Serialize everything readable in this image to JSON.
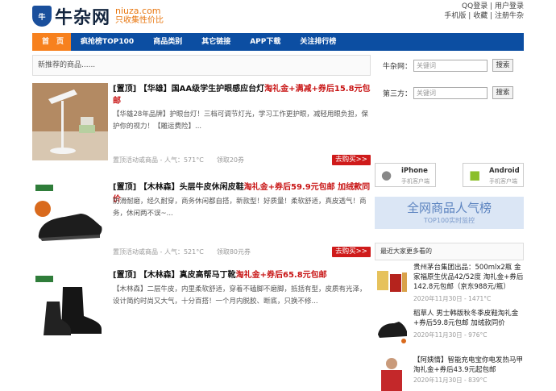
{
  "header": {
    "logo_badge": "牛",
    "logo_text": "牛杂网",
    "domain": "niuza.com",
    "slogan": "只收集性价比",
    "top_links": [
      "QQ登录",
      "用户登录",
      "手机版",
      "收藏",
      "注册牛杂"
    ]
  },
  "nav": {
    "items": [
      "首　页",
      "疯抢榜TOP100",
      "商品类别",
      "其它链接",
      "APP下载",
      "关注排行榜"
    ],
    "active_color": "#f7811e",
    "bar_color": "#0c4ea2"
  },
  "main": {
    "breadcrumb": "新推荐的商品......",
    "posts": [
      {
        "title_prefix": "[置顶] 【华雄】国AA级学生护眼感应台灯",
        "title_red": "淘礼金+满减+券后15.8元包邮",
        "desc": "【华雄28年品牌】护眼台灯！三档可调节灯光，学习工作更护眼，减轻用眼负担，保护你的视力！【雕运费险】...",
        "meta": "置顶活动或商品 - 人气：571°C　　领取20券",
        "buy": "去购买>>"
      },
      {
        "title_prefix": "[置顶] 【木林森】头层牛皮休闲皮鞋",
        "title_red": "淘礼金+券后59.9元包邮 加绒款同价",
        "desc": "防滑耐磨，经久耐穿，商务休闲都自搭，新款型！好质量！柔软舒适，真皮透气！商务，休闲两不误~...",
        "meta": "置顶活动或商品 - 人气：521°C　　领取80元券",
        "buy": "去购买>>"
      },
      {
        "title_prefix": "[置顶] 【木林森】真皮高帮马丁靴",
        "title_red": "淘礼金+券后65.8元包邮",
        "desc": "【木林森】二层牛皮，内里柔软舒适，穿着不磕脚不磨脚，抵括有型，皮质有光泽，设计简约时尚又大气，十分百搭！一个月内脱胶、断底，只换不修...",
        "meta": "",
        "buy": ""
      }
    ]
  },
  "sidebar": {
    "search": [
      {
        "label": "牛杂网：",
        "placeholder": "关键词",
        "button": "搜索"
      },
      {
        "label": "第三方：",
        "placeholder": "关键词",
        "button": "搜索"
      }
    ],
    "apps": [
      {
        "name": "iPhone",
        "sub": "手机客户端",
        "icon": "apple-icon"
      },
      {
        "name": "Android",
        "sub": "手机客户端",
        "icon": "android-icon"
      }
    ],
    "banner_title": "全网商品人气榜",
    "banner_sub": "TOP100实时监控",
    "section_title": "最近大家更多看的",
    "items": [
      {
        "title": "贵州茅台集团出品：500mlx2瓶 金家福原生优品42/52度 淘礼金+券后142.8元包邮（京东988元/瓶）",
        "meta": "2020年11月30日 - 1471°C"
      },
      {
        "title": "稻草人 男士韩版秋冬季皮鞋淘礼金+券后59.8元包邮 加绒款同价",
        "meta": "2020年11月30日 - 976°C"
      },
      {
        "title": "【阿姨情】智能充电宝你电发热马甲淘礼金+券后43.9元起包邮",
        "meta": "2020年11月30日 - 839°C"
      }
    ]
  }
}
